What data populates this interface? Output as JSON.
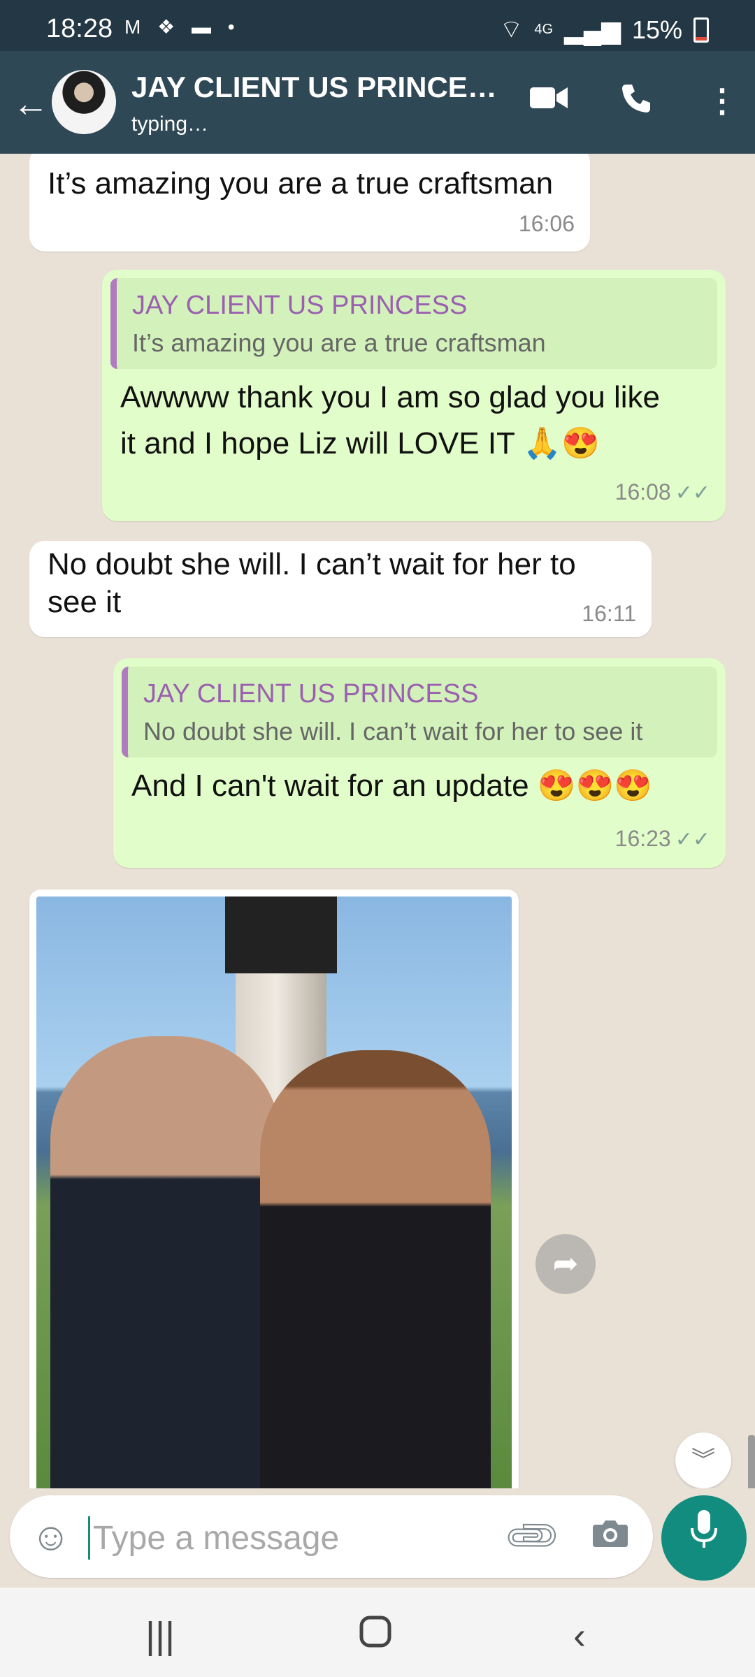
{
  "status_bar": {
    "time": "18:28",
    "left_icons": "M ❖ ▬ •",
    "network": "4G",
    "battery": "15%"
  },
  "header": {
    "contact_name": "JAY CLIENT US PRINCE…",
    "status": "typing…"
  },
  "messages": [
    {
      "type": "incoming",
      "text": "It’s amazing you are a true craftsman",
      "time": "16:06"
    },
    {
      "type": "outgoing",
      "quoted_name": "JAY CLIENT US PRINCESS",
      "quoted_text": "It’s amazing you are a true craftsman",
      "text_line1": "Awwww thank you I am so glad you like",
      "text_line2": "it and I hope Liz will LOVE IT 🙏😍",
      "time": "16:08",
      "ticks": "✓✓"
    },
    {
      "type": "incoming",
      "text_line1": "No doubt she will. I can’t wait for her to",
      "text_line2": "see it",
      "time": "16:11"
    },
    {
      "type": "outgoing",
      "quoted_name": "JAY CLIENT US PRINCESS",
      "quoted_text": "No doubt she will. I can’t wait for her to see it",
      "text": "And I can't wait for an update 😍😍😍",
      "time": "16:23",
      "ticks": "✓✓"
    }
  ],
  "composer": {
    "placeholder": "Type a message"
  },
  "colors": {
    "header": "#2f4856",
    "status_bar": "#233844",
    "outgoing_bubble": "#e1fdc9",
    "quote_name": "#9b5fb0",
    "accent": "#128c7e"
  },
  "icons": {
    "back": "back-arrow-icon",
    "video": "video-call-icon",
    "call": "phone-icon",
    "menu": "more-vert-icon",
    "emoji": "emoji-icon",
    "attach": "attach-icon",
    "camera": "camera-icon",
    "mic": "mic-icon",
    "share": "share-icon",
    "scroll_down": "double-chevron-down-icon"
  }
}
